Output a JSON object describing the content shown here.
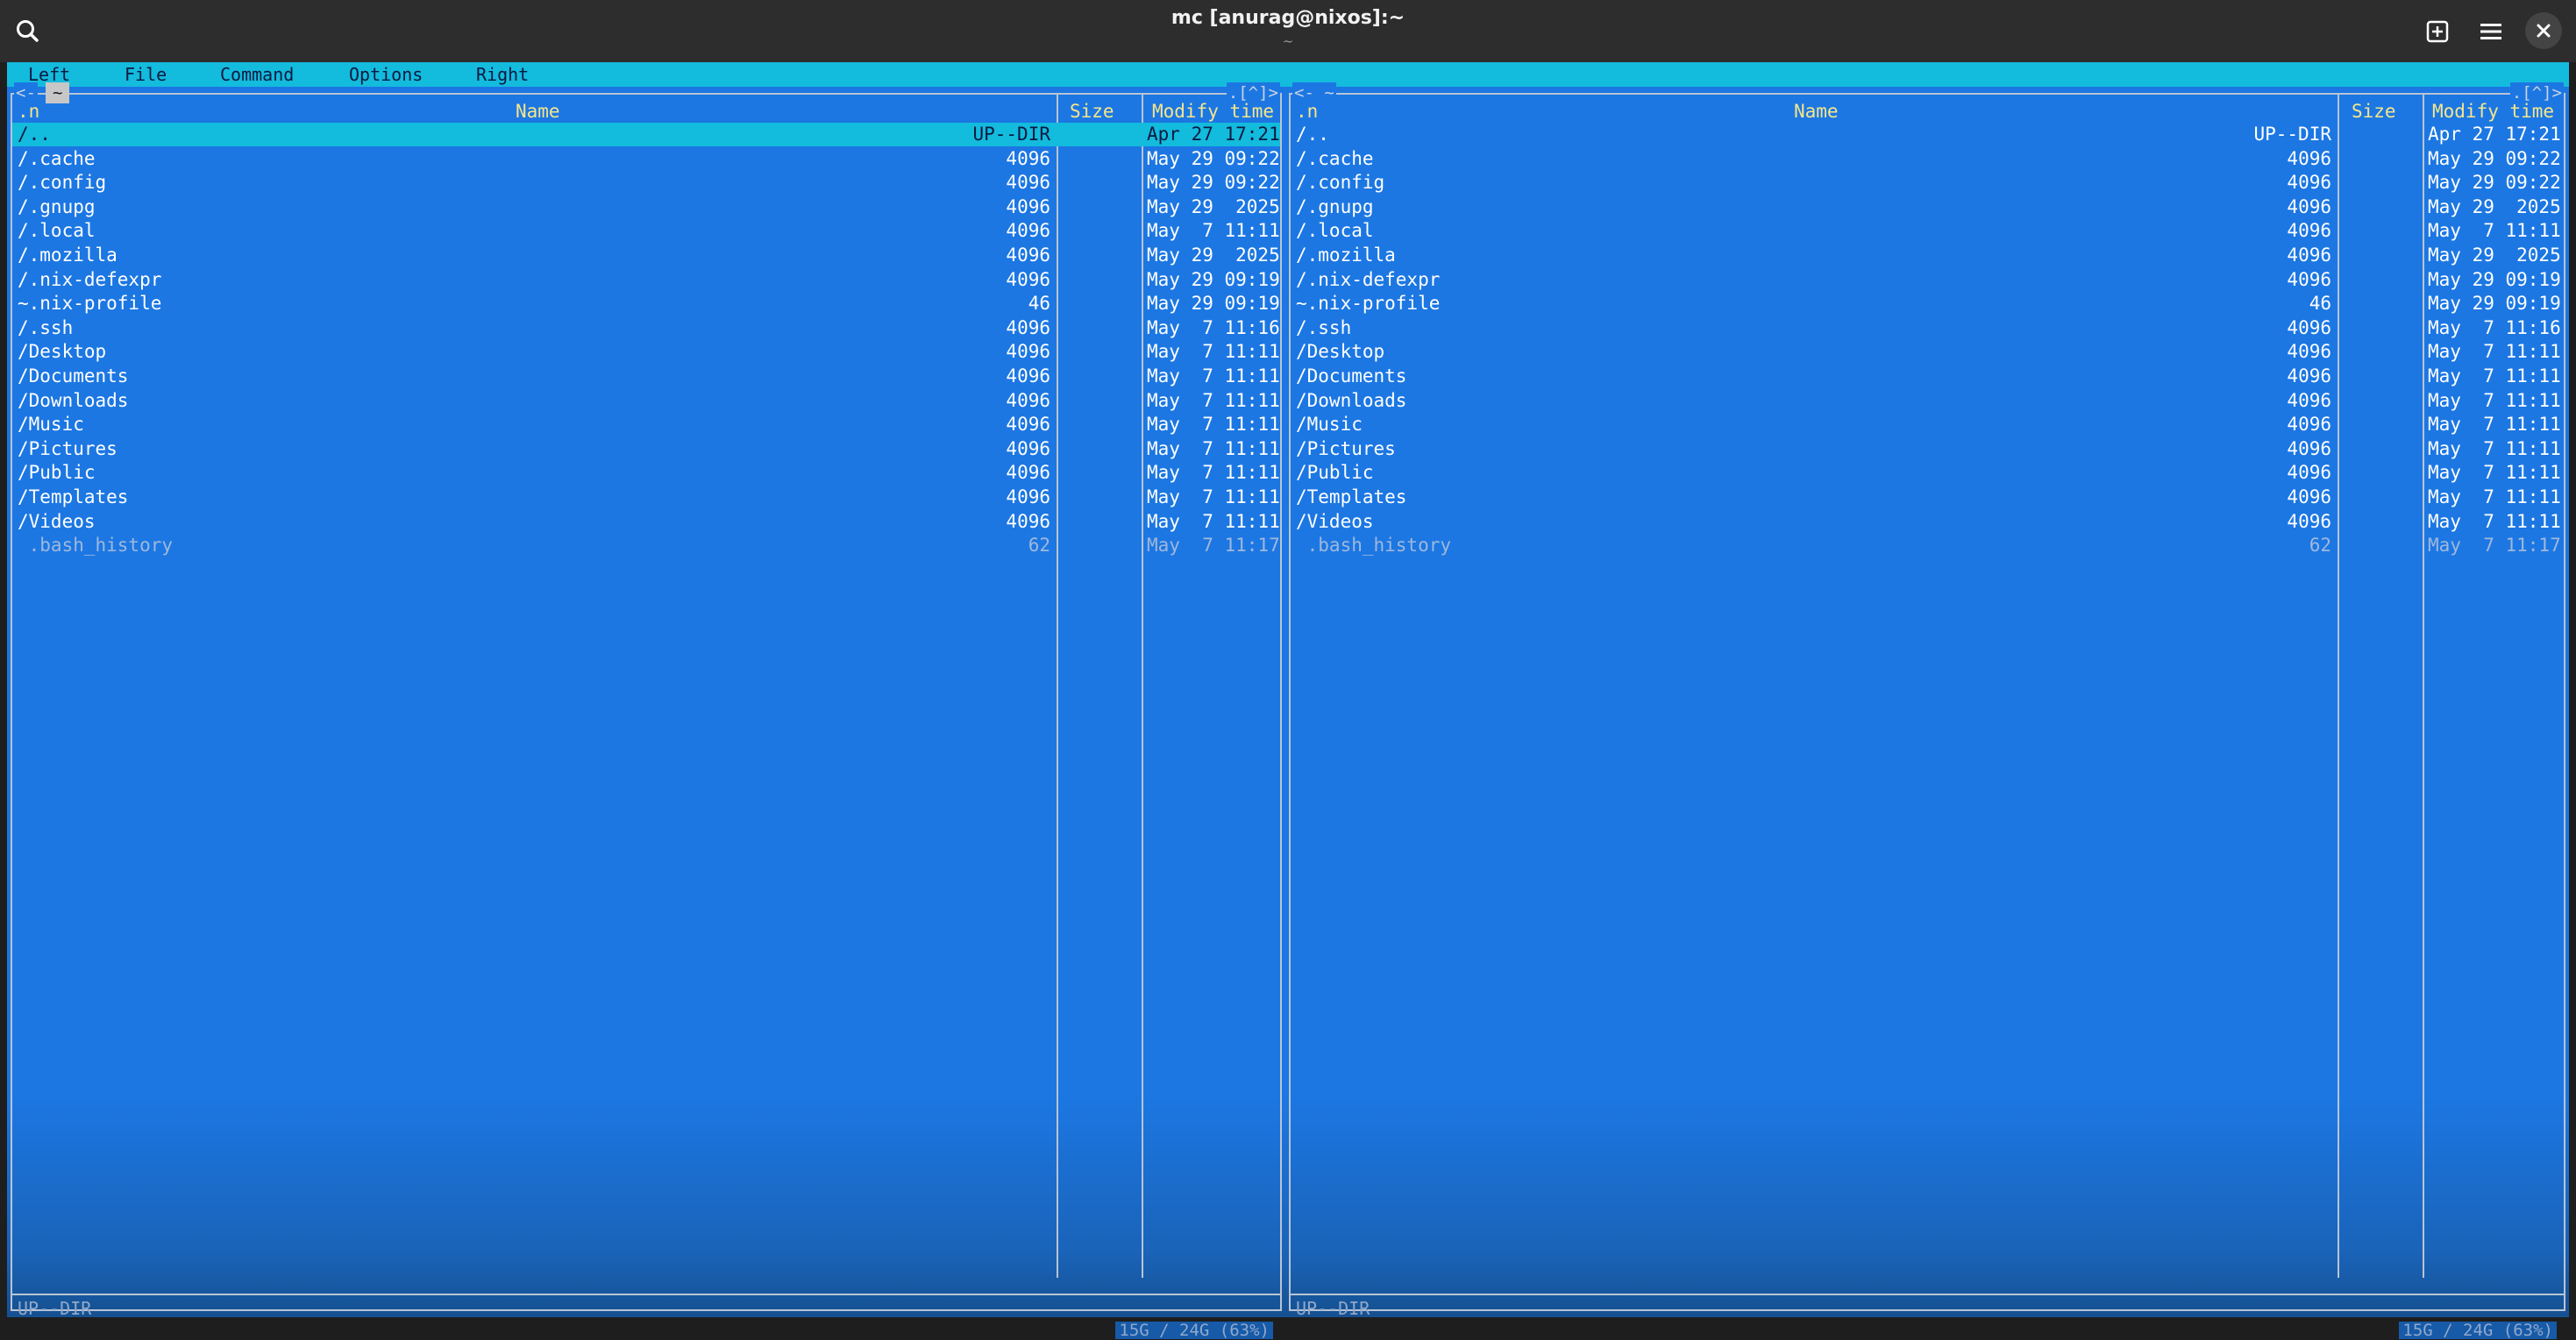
{
  "window": {
    "title": "mc [anurag@nixos]:~",
    "subtitle": "~"
  },
  "menubar": {
    "left": "Left",
    "file": "File",
    "command": "Command",
    "options": "Options",
    "right": "Right"
  },
  "left_panel": {
    "top_left": "<-",
    "top_marker": "~",
    "top_right": ".[^]>",
    "headers": {
      "n": ".n",
      "name": "Name",
      "size": "Size",
      "mtime": "Modify time"
    },
    "rows": [
      {
        "name": "/..",
        "size": "UP--DIR",
        "mtime": "Apr 27 17:21"
      },
      {
        "name": "/.cache",
        "size": "4096",
        "mtime": "May 29 09:22"
      },
      {
        "name": "/.config",
        "size": "4096",
        "mtime": "May 29 09:22"
      },
      {
        "name": "/.gnupg",
        "size": "4096",
        "mtime": "May 29  2025"
      },
      {
        "name": "/.local",
        "size": "4096",
        "mtime": "May  7 11:11"
      },
      {
        "name": "/.mozilla",
        "size": "4096",
        "mtime": "May 29  2025"
      },
      {
        "name": "/.nix-defexpr",
        "size": "4096",
        "mtime": "May 29 09:19"
      },
      {
        "name": "~.nix-profile",
        "size": "46",
        "mtime": "May 29 09:19"
      },
      {
        "name": "/.ssh",
        "size": "4096",
        "mtime": "May  7 11:16"
      },
      {
        "name": "/Desktop",
        "size": "4096",
        "mtime": "May  7 11:11"
      },
      {
        "name": "/Documents",
        "size": "4096",
        "mtime": "May  7 11:11"
      },
      {
        "name": "/Downloads",
        "size": "4096",
        "mtime": "May  7 11:11"
      },
      {
        "name": "/Music",
        "size": "4096",
        "mtime": "May  7 11:11"
      },
      {
        "name": "/Pictures",
        "size": "4096",
        "mtime": "May  7 11:11"
      },
      {
        "name": "/Public",
        "size": "4096",
        "mtime": "May  7 11:11"
      },
      {
        "name": "/Templates",
        "size": "4096",
        "mtime": "May  7 11:11"
      },
      {
        "name": "/Videos",
        "size": "4096",
        "mtime": "May  7 11:11"
      },
      {
        "name": " .bash_history",
        "size": "62",
        "mtime": "May  7 11:17"
      }
    ],
    "status": "UP--DIR",
    "disk": "15G / 24G (63%)"
  },
  "right_panel": {
    "top_left": "<- ~",
    "top_right": ".[^]>",
    "headers": {
      "n": ".n",
      "name": "Name",
      "size": "Size",
      "mtime": "Modify time"
    },
    "rows": [
      {
        "name": "/..",
        "size": "UP--DIR",
        "mtime": "Apr 27 17:21"
      },
      {
        "name": "/.cache",
        "size": "4096",
        "mtime": "May 29 09:22"
      },
      {
        "name": "/.config",
        "size": "4096",
        "mtime": "May 29 09:22"
      },
      {
        "name": "/.gnupg",
        "size": "4096",
        "mtime": "May 29  2025"
      },
      {
        "name": "/.local",
        "size": "4096",
        "mtime": "May  7 11:11"
      },
      {
        "name": "/.mozilla",
        "size": "4096",
        "mtime": "May 29  2025"
      },
      {
        "name": "/.nix-defexpr",
        "size": "4096",
        "mtime": "May 29 09:19"
      },
      {
        "name": "~.nix-profile",
        "size": "46",
        "mtime": "May 29 09:19"
      },
      {
        "name": "/.ssh",
        "size": "4096",
        "mtime": "May  7 11:16"
      },
      {
        "name": "/Desktop",
        "size": "4096",
        "mtime": "May  7 11:11"
      },
      {
        "name": "/Documents",
        "size": "4096",
        "mtime": "May  7 11:11"
      },
      {
        "name": "/Downloads",
        "size": "4096",
        "mtime": "May  7 11:11"
      },
      {
        "name": "/Music",
        "size": "4096",
        "mtime": "May  7 11:11"
      },
      {
        "name": "/Pictures",
        "size": "4096",
        "mtime": "May  7 11:11"
      },
      {
        "name": "/Public",
        "size": "4096",
        "mtime": "May  7 11:11"
      },
      {
        "name": "/Templates",
        "size": "4096",
        "mtime": "May  7 11:11"
      },
      {
        "name": "/Videos",
        "size": "4096",
        "mtime": "May  7 11:11"
      },
      {
        "name": " .bash_history",
        "size": "62",
        "mtime": "May  7 11:17"
      }
    ],
    "status": "UP--DIR",
    "disk": "15G / 24G (63%)"
  },
  "colors": {
    "panel_bg": "#1c77e3",
    "menubar_bg": "#13bbdd",
    "header_text": "#f5e68a",
    "selection_bg": "#13bbdd"
  }
}
